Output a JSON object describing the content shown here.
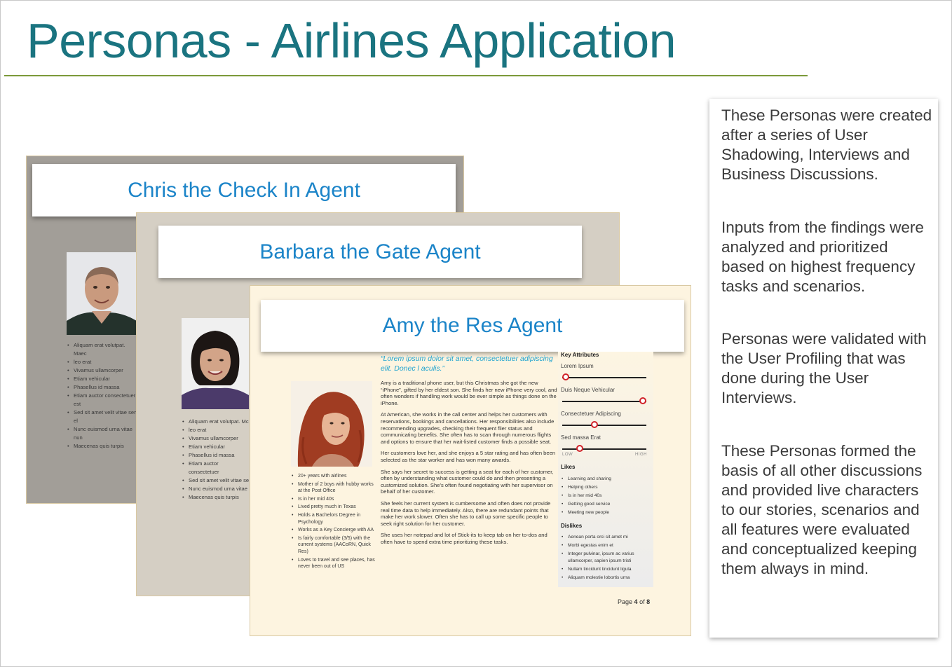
{
  "slide": {
    "title": "Personas - Airlines Application",
    "accent_color": "#1a7480",
    "rule_color": "#7c9a3a"
  },
  "personas": {
    "chris": {
      "name": "Chris the Check In Agent",
      "bullets": [
        "Aliquam erat volutpat. Maec",
        "leo erat",
        "Vivamus ullamcorper",
        "Etiam vehicular",
        "Phasellus id massa",
        "Etiam auctor consectetuer est",
        "Sed sit amet velit vitae sem el",
        "Nunc euismod urna vitae nun",
        "Maecenas quis turpis"
      ]
    },
    "barbara": {
      "name": "Barbara the Gate Agent",
      "bullets": [
        "Aliquam erat volutpat. Mc",
        "leo erat",
        "Vivamus ullamcorper",
        "Etiam vehicular",
        "Phasellus id massa",
        "Etiam auctor consectetuer",
        "Sed sit amet velit vitae se",
        "Nunc euismod urna vitae",
        "Maecenas quis turpis"
      ]
    },
    "amy": {
      "name": "Amy the Res Agent",
      "quote": "“Lorem ipsum dolor sit amet, consectetuer adipiscing elit. Donec l aculis.”",
      "facts": [
        "20+ years with airlines",
        "Mother of 2 boys with hubby works at the Post Office",
        "Is in her mid 40s",
        "Lived pretty much in Texas",
        "Holds a Bachelors Degree in Psychology",
        "Works as a Key Concierge with AA",
        "Is fairly comfortable (3/5) with the current systems (AACoRN, Quick Res)",
        "Loves to travel and see places, has never been out of US"
      ],
      "paragraphs": [
        "Amy is a traditional phone user, but this Christmas she got the new “iPhone”, gifted by her eldest son. She finds her new iPhone very cool, and often wonders if handling work would be ever simple as things done on the iPhone.",
        "At American, she works in the call center and helps her customers with reservations, bookings and cancellations. Her responsibilities also include recommending upgrades, checking their frequent flier status and communicating benefits. She often has to scan through numerous flights and options to ensure that her wait-listed customer finds a possible seat.",
        "Her customers love her, and she enjoys a 5 star rating and has often been selected as the star worker and has won many awards.",
        "She says her secret to success is getting a seat for each of her customer, often by understanding what customer could do and then presenting a customized solution. She’s often found negotiating with her supervisor on behalf of her customer.",
        "She feels her current system is cumbersome and often does not provide real time data to help immediately. Also, there are redundant points that make her work slower. Often she has to call up some specific people to seek right solution for her customer.",
        "She uses her notepad and lot of Stick-its to keep tab on her to-dos and often have to spend extra time prioritizing these tasks."
      ],
      "key_attributes_title": "Key Attributes",
      "attributes": [
        {
          "label": "Lorem Ipsum",
          "level": 0.04
        },
        {
          "label": "Duis Neque Vehicular",
          "level": 0.96
        },
        {
          "label": "Consectetuer Adipiscing",
          "level": 0.38
        },
        {
          "label": "Sed massa Erat",
          "level": 0.21
        }
      ],
      "scale_low": "LOW",
      "scale_high": "HIGH",
      "likes_title": "Likes",
      "likes": [
        "Learning and sharing",
        "Helping others",
        "Is in her mid 40s",
        "Getting good service",
        "Meeting new people"
      ],
      "dislikes_title": "Dislikes",
      "dislikes": [
        "Aenean porta orci sit amet mi",
        "Morbi egestas enim et",
        "Integer pulvinar, ipsum ac varius ullamcorper, sapien ipsum tristi",
        "Nullam tincidunt tincidunt ligula",
        "Aliquam molestie lobortis urna"
      ],
      "page": {
        "prefix": "Page",
        "current": "4",
        "of": "of",
        "total": "8"
      }
    }
  },
  "notes": [
    "These Personas were created after a series of User Shadowing, Interviews and Business Discussions.",
    "Inputs from the findings were analyzed and prioritized based on highest frequency tasks and scenarios.",
    "Personas were validated with the User Profiling that was done during the User Interviews.",
    "These Personas formed the basis of all other discussions and provided live characters to our stories, scenarios and all features were evaluated and conceptualized keeping them always in mind."
  ]
}
